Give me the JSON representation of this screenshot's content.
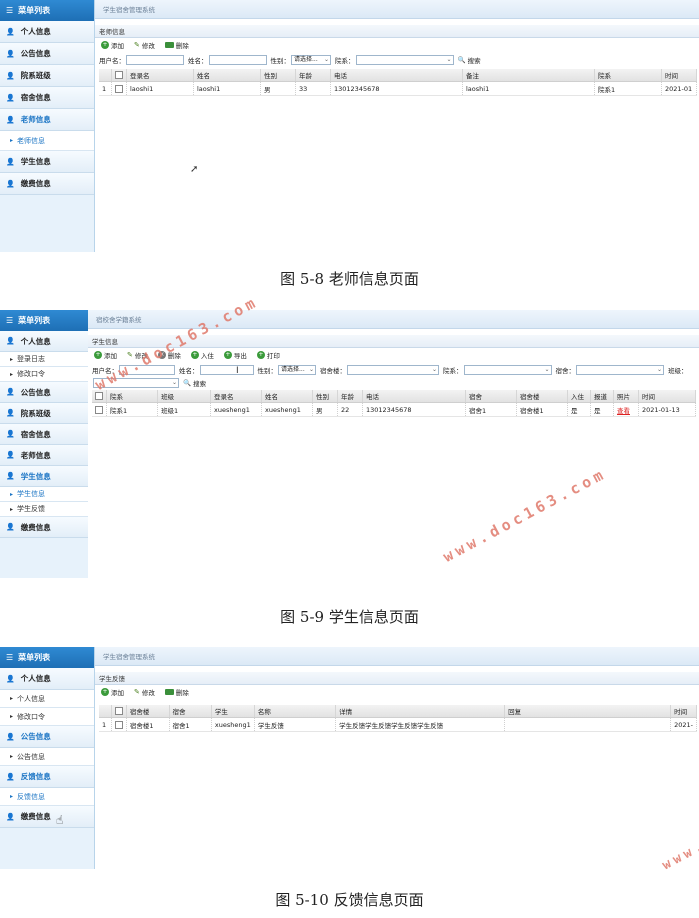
{
  "shot1": {
    "sidebar_header": "菜单列表",
    "sidebar_items": [
      {
        "label": "个人信息"
      },
      {
        "label": "公告信息"
      },
      {
        "label": "院系班级"
      },
      {
        "label": "宿舍信息"
      },
      {
        "label": "老师信息",
        "active": true
      },
      {
        "sub": "老师信息"
      },
      {
        "label": "学生信息"
      },
      {
        "label": "缴费信息"
      }
    ],
    "app_title": "学生宿舍管理系统",
    "panel_title": "老师信息",
    "toolbar": {
      "add": "添加",
      "edit": "修改",
      "delete": "删除"
    },
    "filters": {
      "username_label": "用户名：",
      "name_label": "姓名：",
      "gender_label": "性别：",
      "gender_value": "请选择...",
      "dept_label": "院系：",
      "search": "搜索"
    },
    "columns": [
      "登录名",
      "姓名",
      "性别",
      "年龄",
      "电话",
      "备注",
      "院系",
      "时间"
    ],
    "rows": [
      {
        "index": "1",
        "cells": [
          "laoshi1",
          "laoshi1",
          "男",
          "33",
          "13012345678",
          "laoshi1",
          "院系1",
          "2021-01"
        ]
      }
    ]
  },
  "caption1": "图 5-8 老师信息页面",
  "shot2": {
    "sidebar_header": "菜单列表",
    "sidebar_items": [
      {
        "label": "个人信息"
      },
      {
        "sub": "登录日志"
      },
      {
        "sub": "修改口令"
      },
      {
        "label": "公告信息"
      },
      {
        "label": "院系班级"
      },
      {
        "label": "宿舍信息"
      },
      {
        "label": "老师信息"
      },
      {
        "label": "学生信息",
        "active": true
      },
      {
        "sub": "学生信息",
        "active": true
      },
      {
        "sub": "学生反馈"
      },
      {
        "label": "缴费信息"
      }
    ],
    "app_title": "宿校舍学籍系统",
    "panel_title": "学生信息",
    "toolbar": {
      "add": "添加",
      "edit": "修改",
      "delete": "删除",
      "checkin": "入住",
      "export": "导出",
      "print": "打印"
    },
    "filters": {
      "username_label": "用户名：",
      "name_label": "姓名：",
      "gender_label": "性别：",
      "gender_value": "请选择...",
      "building_label": "宿舍楼：",
      "dept_label": "院系：",
      "dorm_label": "宿舍：",
      "class_label": "班级：",
      "search": "搜索"
    },
    "columns": [
      "院系",
      "班级",
      "登录名",
      "姓名",
      "性别",
      "年龄",
      "电话",
      "宿舍",
      "宿舍楼",
      "入住",
      "报道",
      "照片",
      "时间"
    ],
    "rows": [
      {
        "cells": [
          "院系1",
          "班级1",
          "xuesheng1",
          "xuesheng1",
          "男",
          "22",
          "13012345678",
          "宿舍1",
          "宿舍楼1",
          "是",
          "是",
          "查看",
          "2021-01-13"
        ]
      }
    ]
  },
  "caption2": "图 5-9 学生信息页面",
  "shot3": {
    "sidebar_header": "菜单列表",
    "sidebar_items": [
      {
        "label": "个人信息"
      },
      {
        "sub": "个人信息"
      },
      {
        "sub": "修改口令"
      },
      {
        "label": "公告信息"
      },
      {
        "sub": "公告信息"
      },
      {
        "label": "反馈信息",
        "active": true
      },
      {
        "sub": "反馈信息",
        "active": true
      },
      {
        "label": "缴费信息"
      }
    ],
    "app_title": "学生宿舍管理系统",
    "panel_title": "学生反馈",
    "toolbar": {
      "add": "添加",
      "edit": "修改",
      "delete": "删除"
    },
    "columns": [
      "宿舍楼",
      "宿舍",
      "学生",
      "名称",
      "详情",
      "回复",
      "时间"
    ],
    "rows": [
      {
        "index": "1",
        "cells": [
          "宿舍楼1",
          "宿舍1",
          "xuesheng1",
          "学生反馈",
          "学生反馈学生反馈学生反馈学生反馈",
          "",
          "2021-"
        ]
      }
    ]
  },
  "caption3": "图 5-10 反馈信息页面",
  "watermarks": [
    "www.doc163.com",
    "www.doc163.com",
    "www.doc163.com",
    "www.d"
  ],
  "colors": {
    "sidebar_header": "#1e6fb5",
    "active_text": "#1a74c4",
    "watermark": "#e07a6c",
    "link_red": "#dd2222"
  }
}
